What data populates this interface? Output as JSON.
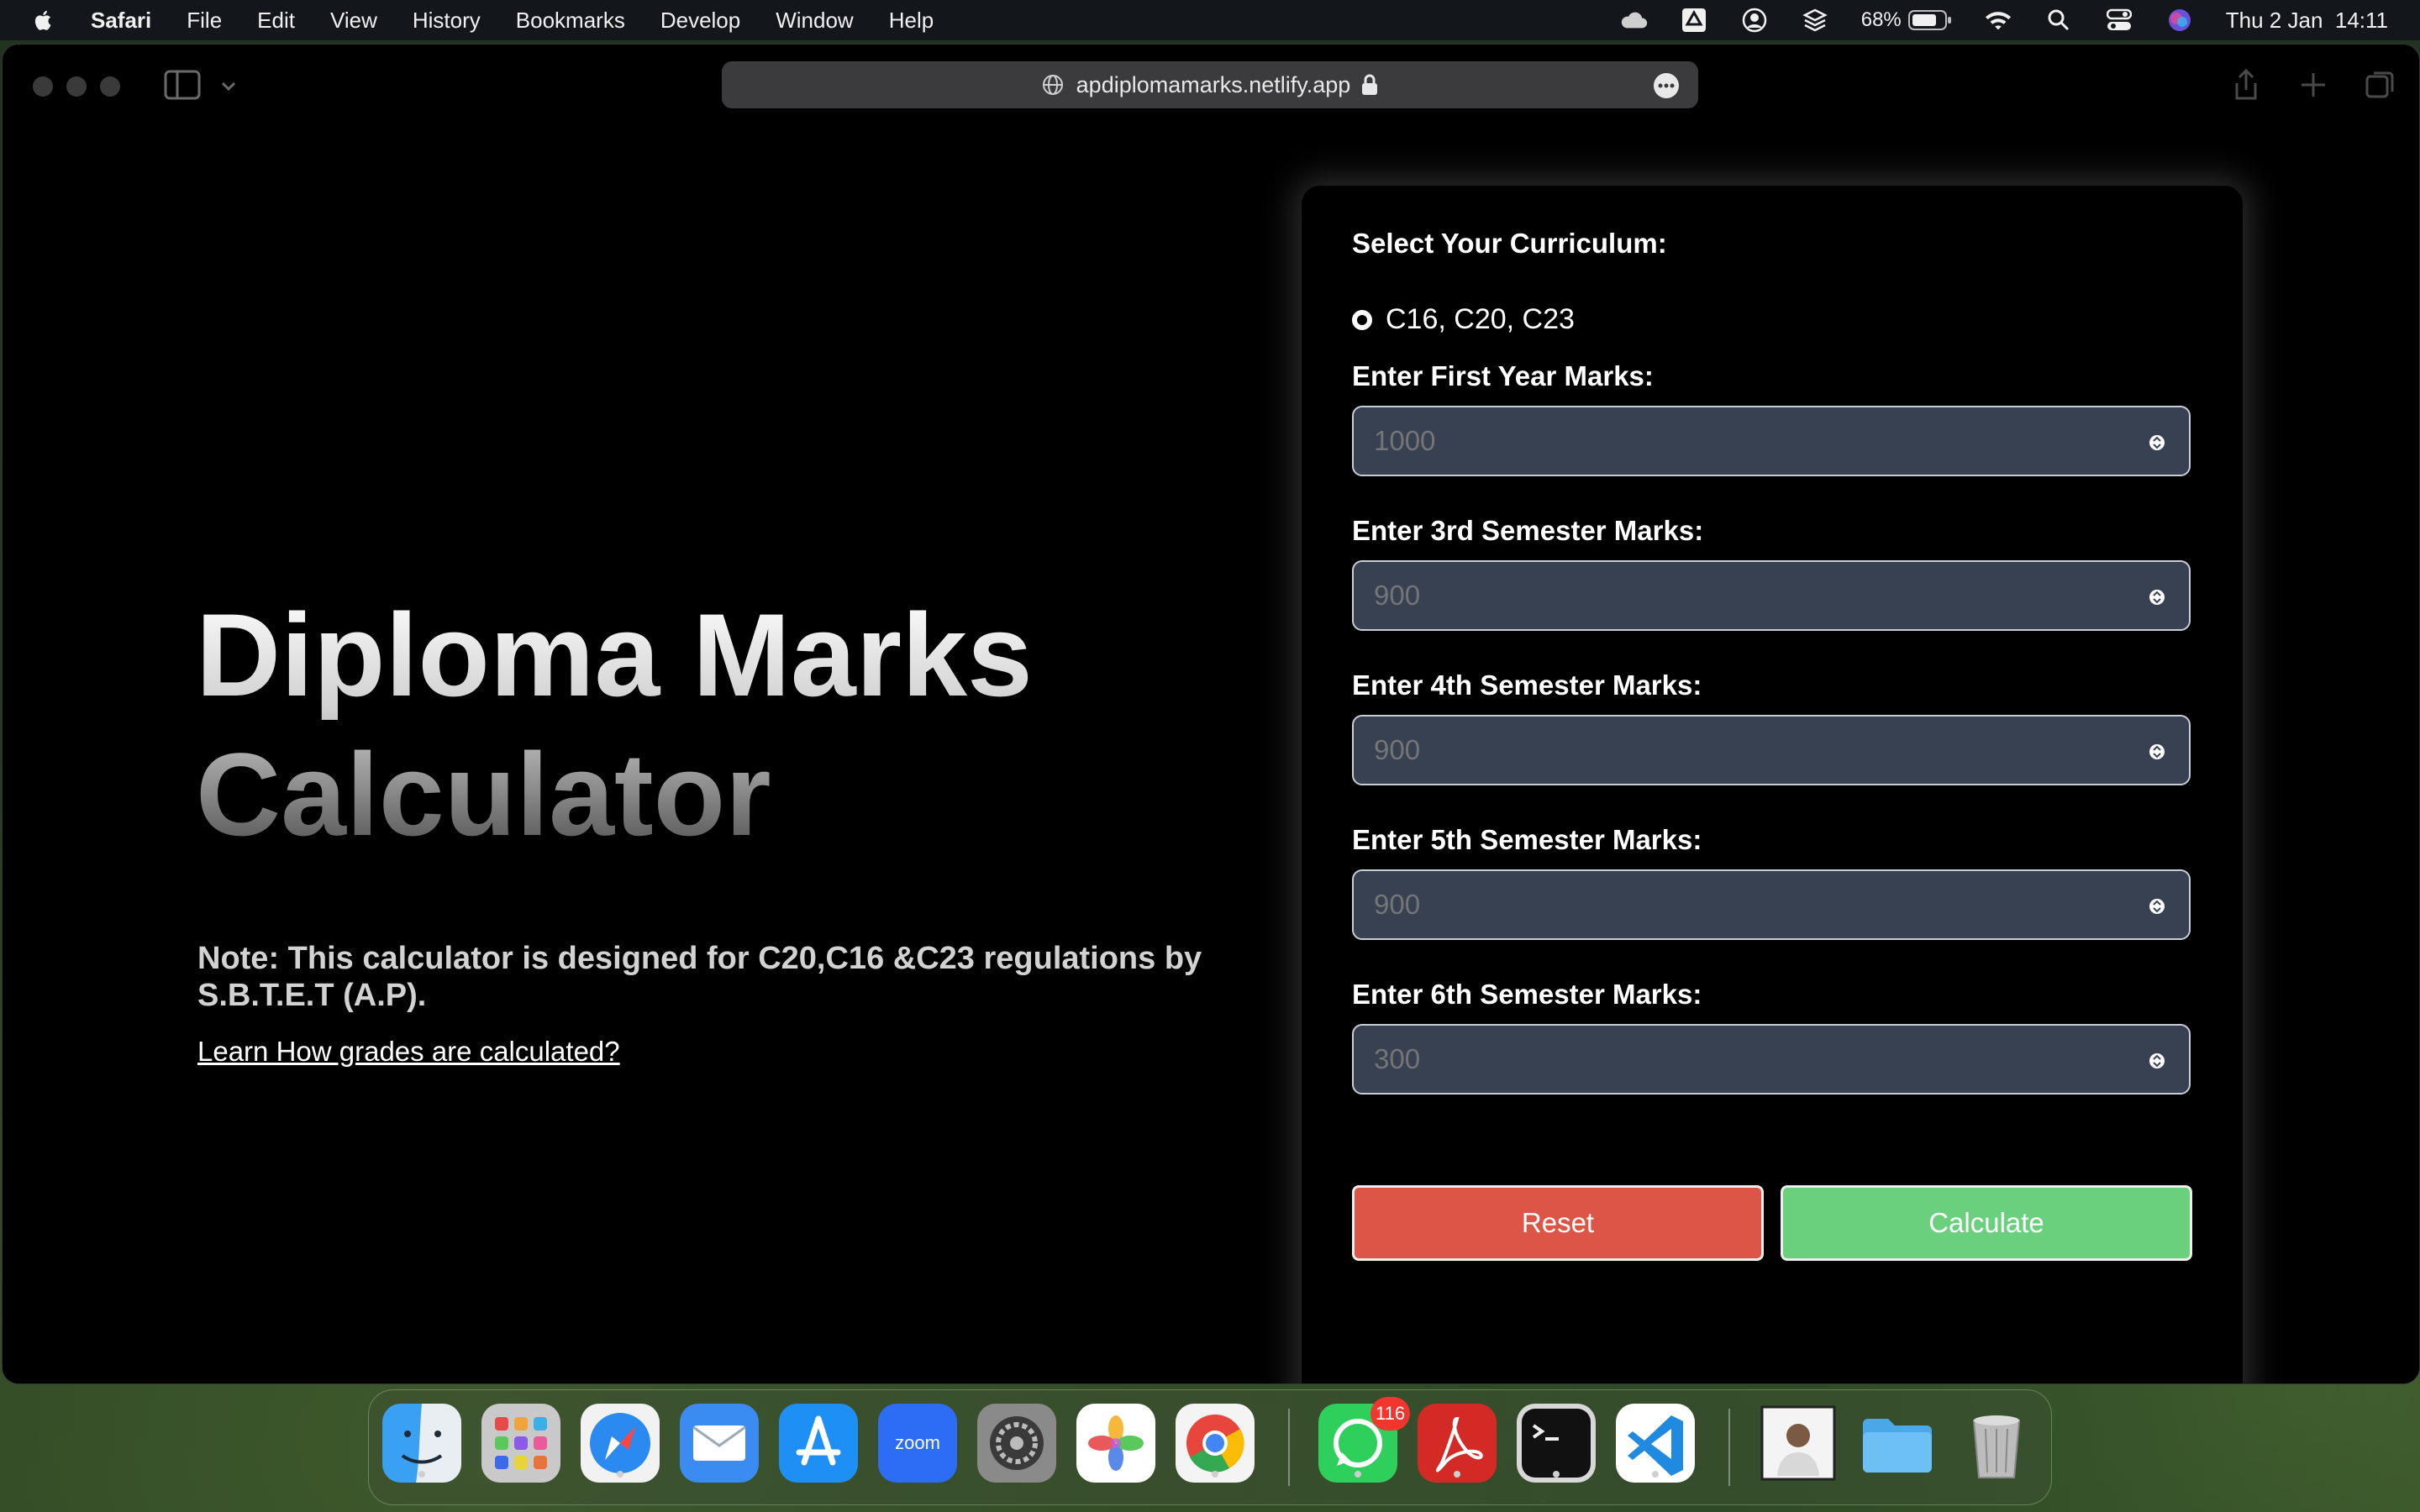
{
  "menubar": {
    "app": "Safari",
    "items": [
      "File",
      "Edit",
      "View",
      "History",
      "Bookmarks",
      "Develop",
      "Window",
      "Help"
    ],
    "battery": "68%",
    "datetime": "Thu 2 Jan  14:11"
  },
  "browser": {
    "url": "apdiplomamarks.netlify.app"
  },
  "hero": {
    "title_line1": "Diploma Marks",
    "title_line2": "Calculator",
    "note": "Note: This calculator is designed for C20,C16 &C23 regulations by S.B.T.E.T (A.P).",
    "learn_link": "Learn How grades are calculated?"
  },
  "form": {
    "curriculum_label": "Select Your Curriculum:",
    "curriculum_option": "C16, C20, C23",
    "fields": [
      {
        "label": "Enter First Year Marks:",
        "placeholder": "1000"
      },
      {
        "label": "Enter 3rd Semester Marks:",
        "placeholder": "900"
      },
      {
        "label": "Enter 4th Semester Marks:",
        "placeholder": "900"
      },
      {
        "label": "Enter 5th Semester Marks:",
        "placeholder": "900"
      },
      {
        "label": "Enter 6th Semester Marks:",
        "placeholder": "300"
      }
    ],
    "reset_label": "Reset",
    "calculate_label": "Calculate"
  },
  "colors": {
    "reset": "#dc5546",
    "calculate": "#6bd07e",
    "input_bg": "#374151"
  },
  "dock": {
    "apps": [
      "Finder",
      "Launchpad",
      "Safari",
      "Mail",
      "App Store",
      "Zoom",
      "System Settings",
      "Photos",
      "Chrome",
      "WhatsApp",
      "Acrobat",
      "Terminal",
      "VS Code",
      "Photo",
      "Folder",
      "Trash"
    ],
    "zoom_label": "zoom",
    "whatsapp_badge": "116"
  }
}
